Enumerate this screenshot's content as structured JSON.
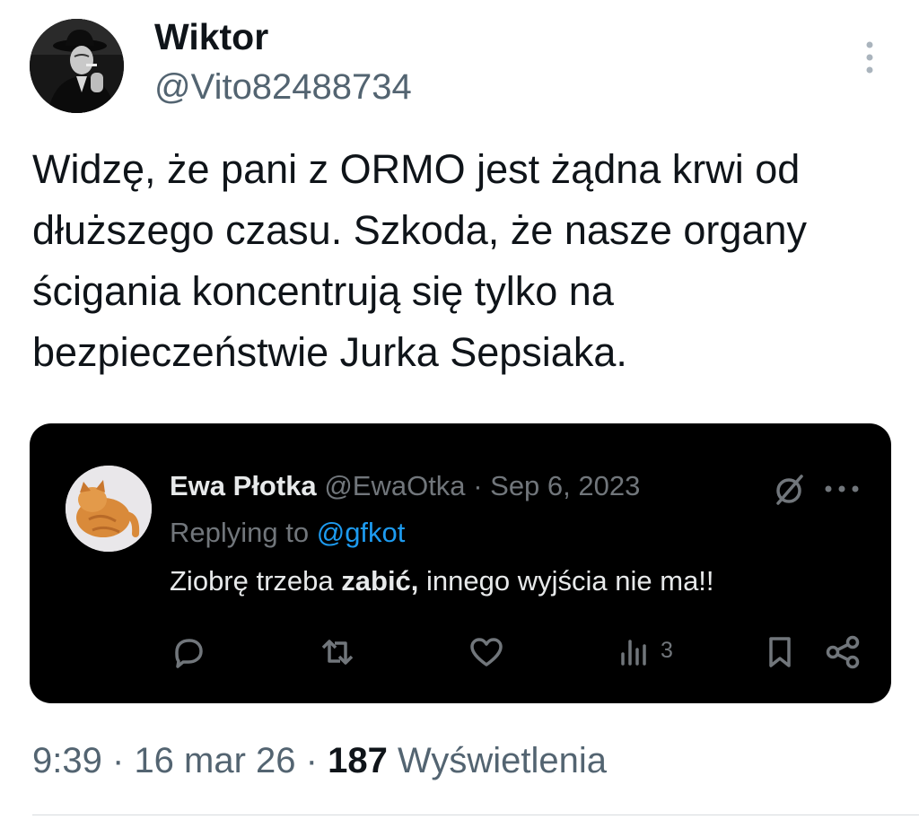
{
  "tweet": {
    "author": {
      "name": "Wiktor",
      "handle": "@Vito82488734"
    },
    "text": "Widzę, że pani z ORMO jest żądna krwi od dłuższego czasu. Szkoda, że nasze organy ścigania koncentrują się tylko na bezpieczeństwie Jurka Sepsiaka.",
    "time": "9:39",
    "date": "16 mar 26",
    "separator": "·",
    "views_count": "187",
    "views_label": "Wyświetlenia"
  },
  "quoted": {
    "name": "Ewa Płotka",
    "handle": "@EwaOtka",
    "separator": "·",
    "date": "Sep 6, 2023",
    "replying_prefix": "Replying to",
    "replying_handle": "@gfkot",
    "text_before": "Ziobrę trzeba",
    "text_bold": "zabić,",
    "text_after": "innego wyjścia nie ma!!",
    "views": "3"
  },
  "icons": {
    "tweet_more": "more-vertical-icon",
    "quote_no_action": "slashed-circle-icon",
    "quote_more": "more-horizontal-icon",
    "reply": "reply-icon",
    "retweet": "retweet-icon",
    "like": "heart-icon",
    "views": "bar-chart-icon",
    "bookmark": "bookmark-icon",
    "share": "share-icon"
  },
  "colors": {
    "text_primary": "#0f1419",
    "text_secondary": "#536471",
    "quote_background": "#000000",
    "quote_text": "#e7e9ea",
    "quote_muted": "#71767b",
    "link": "#1d9bf0"
  }
}
